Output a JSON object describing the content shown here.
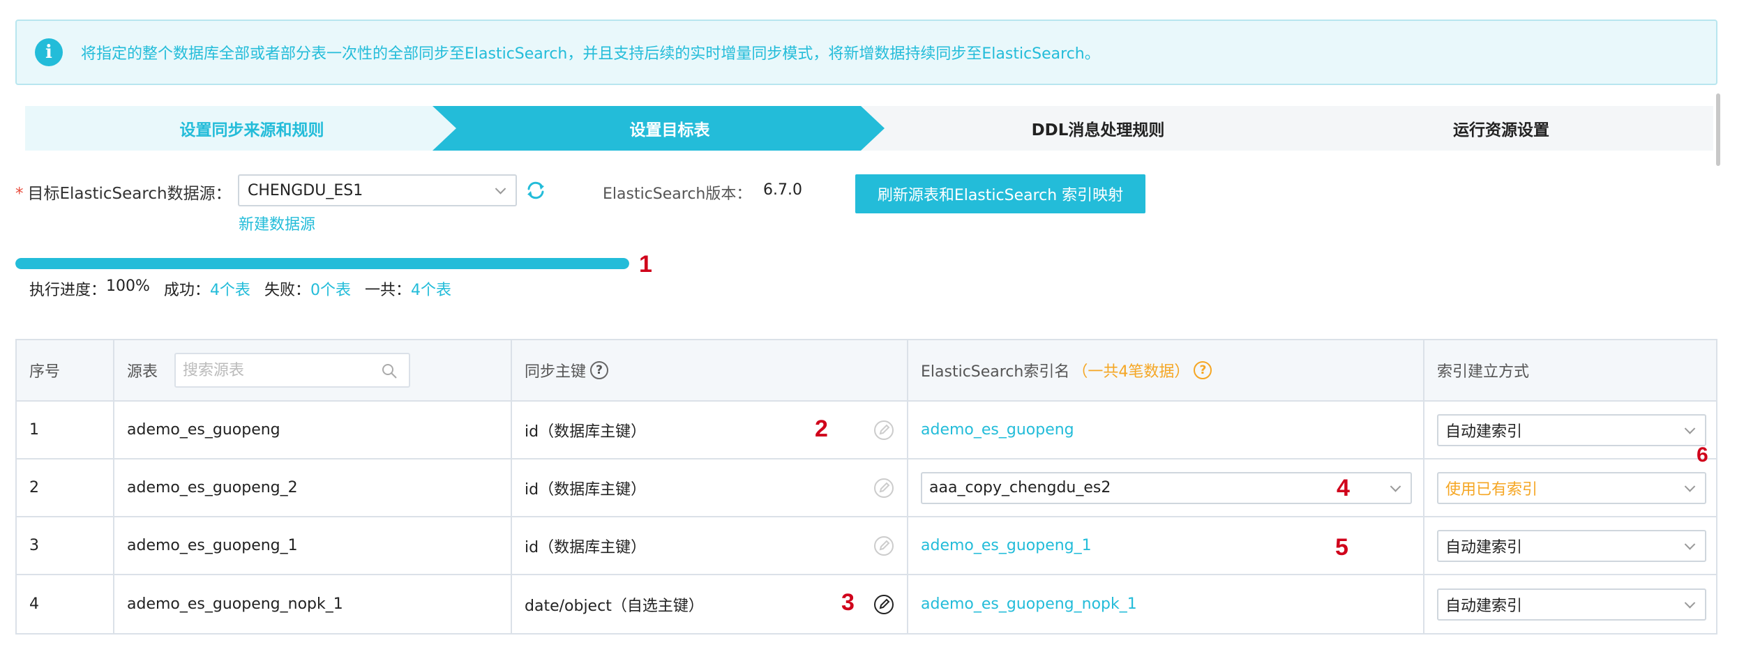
{
  "banner": {
    "icon": "info-icon",
    "text": "将指定的整个数据库全部或者部分表一次性的全部同步至ElasticSearch，并且支持后续的实时增量同步模式，将新增数据持续同步至ElasticSearch。"
  },
  "steps": [
    {
      "label": "设置同步来源和规则",
      "state": "done"
    },
    {
      "label": "设置目标表",
      "state": "active"
    },
    {
      "label": "DDL消息处理规则",
      "state": "pending"
    },
    {
      "label": "运行资源设置",
      "state": "pending"
    }
  ],
  "target": {
    "required_mark": "*",
    "label": "目标ElasticSearch数据源：",
    "selected": "CHENGDU_ES1",
    "new_link": "新建数据源",
    "version_label": "ElasticSearch版本：",
    "version_value": "6.7.0",
    "refresh_button": "刷新源表和ElasticSearch 索引映射"
  },
  "progress": {
    "percent": 100,
    "label": "执行进度：",
    "percent_text": "100%",
    "success_label": "成功：",
    "success_count": "4个表",
    "fail_label": "失败：",
    "fail_count": "0个表",
    "total_label": "一共：",
    "total_count": "4个表"
  },
  "markers": [
    "1",
    "2",
    "3",
    "4",
    "5",
    "6"
  ],
  "table": {
    "headers": {
      "index": "序号",
      "source": "源表",
      "search_placeholder": "搜索源表",
      "pk": "同步主键",
      "es_index": "ElasticSearch索引名",
      "es_count": "（一共4笔数据）",
      "mode": "索引建立方式"
    },
    "rows": [
      {
        "index": "1",
        "source": "ademo_es_guopeng",
        "pk": "id（数据库主键）",
        "es_index": "ademo_es_guopeng",
        "mode": "自动建索引"
      },
      {
        "index": "2",
        "source": "ademo_es_guopeng_2",
        "pk": "id（数据库主键）",
        "es_index": "aaa_copy_chengdu_es2",
        "mode": "使用已有索引"
      },
      {
        "index": "3",
        "source": "ademo_es_guopeng_1",
        "pk": "id（数据库主键）",
        "es_index": "ademo_es_guopeng_1",
        "mode": "自动建索引"
      },
      {
        "index": "4",
        "source": "ademo_es_guopeng_nopk_1",
        "pk": "date/object（自选主键）",
        "es_index": "ademo_es_guopeng_nopk_1",
        "mode": "自动建索引"
      }
    ]
  },
  "colors": {
    "accent": "#23bcd9",
    "warning": "#f5a623",
    "marker": "#d0021b"
  }
}
